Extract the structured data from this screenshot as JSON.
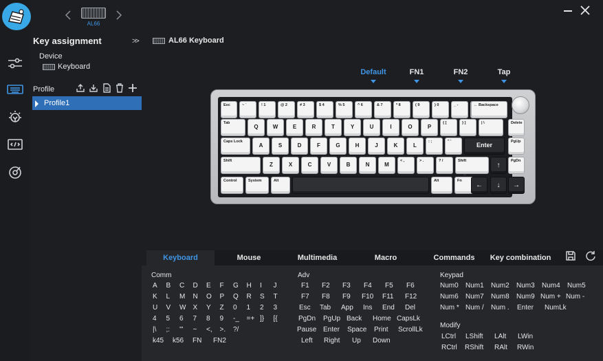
{
  "app": {
    "device_short": "AL66"
  },
  "sidebar": {
    "title": "Key assignment",
    "device_label": "Device",
    "device_value": "Keyboard",
    "profile_label": "Profile",
    "profiles": [
      "Profile1"
    ]
  },
  "main": {
    "keyboard_title": "AL66 Keyboard",
    "layers": [
      "Default",
      "FN1",
      "FN2",
      "Tap"
    ],
    "active_layer": "Default"
  },
  "keyboard": {
    "rows": [
      [
        "Esc",
        "~ `",
        "! 1",
        "@ 2",
        "# 3",
        "$ 4",
        "% 5",
        "^ 6",
        "& 7",
        "* 8",
        "( 9",
        ") 0",
        "_ -",
        "+ =",
        "← Backspace"
      ],
      [
        "Tab",
        "Q",
        "W",
        "E",
        "R",
        "T",
        "Y",
        "U",
        "I",
        "O",
        "P",
        "{ [",
        "} ]",
        "| \\",
        "Delete"
      ],
      [
        "Caps Lock",
        "A",
        "S",
        "D",
        "F",
        "G",
        "H",
        "J",
        "K",
        "L",
        ": ;",
        "\" '",
        "Enter",
        "PgUp"
      ],
      [
        "Shift",
        "Z",
        "X",
        "C",
        "V",
        "B",
        "N",
        "M",
        "< ,",
        "> .",
        "? /",
        "Shift",
        "↑",
        "PgDn"
      ],
      [
        "Control",
        "System",
        "Alt",
        "",
        "Alt",
        "Fn",
        "←",
        "↓",
        "→"
      ]
    ]
  },
  "tabs": [
    "Keyboard",
    "Mouse",
    "Multimedia",
    "Macro",
    "Commands",
    "Key combination"
  ],
  "active_tab": "Keyboard",
  "palette": {
    "comm": {
      "title": "Comm",
      "rows": [
        [
          "A",
          "B",
          "C",
          "D",
          "E",
          "F",
          "G",
          "H",
          "I",
          "J"
        ],
        [
          "K",
          "L",
          "M",
          "N",
          "O",
          "P",
          "Q",
          "R",
          "S",
          "T"
        ],
        [
          "U",
          "V",
          "W",
          "X",
          "Y",
          "Z",
          "0",
          "1",
          "2",
          "3"
        ],
        [
          "4",
          "5",
          "6",
          "7",
          "8",
          "9",
          "-_",
          "=+",
          "]}",
          "[{"
        ],
        [
          "|\\",
          ";:",
          "'\"",
          "~",
          "<,",
          ">.",
          "?/"
        ],
        [
          "k45",
          "k56",
          "FN",
          "FN2"
        ]
      ]
    },
    "adv": {
      "title": "Adv",
      "rows": [
        [
          "F1",
          "F2",
          "F3",
          "F4",
          "F5",
          "F6"
        ],
        [
          "F7",
          "F8",
          "F9",
          "F10",
          "F11",
          "F12"
        ],
        [
          "Esc",
          "Tab",
          "App",
          "Ins",
          "End",
          "Del"
        ],
        [
          "PgDn",
          "PgUp",
          "Back",
          "Home",
          "CapsLk"
        ],
        [
          "Pause",
          "Enter",
          "Space",
          "Print",
          "ScrollLk"
        ],
        [
          "Left",
          "Right",
          "Up",
          "Down"
        ]
      ]
    },
    "keypad": {
      "title": "Keypad",
      "rows": [
        [
          "Num0",
          "Num1",
          "Num2",
          "Num3",
          "Num4",
          "Num5"
        ],
        [
          "Num6",
          "Num7",
          "Num8",
          "Num9",
          "Num +",
          "Num -"
        ],
        [
          "Num *",
          "Num /",
          "Num .",
          "Enter",
          "NumLk"
        ]
      ]
    },
    "modify": {
      "title": "Modify",
      "rows": [
        [
          "LCtrl",
          "LShift",
          "LAlt",
          "LWin"
        ],
        [
          "RCtrl",
          "RShift",
          "RAlt",
          "RWin"
        ]
      ]
    }
  },
  "colors": {
    "accent": "#3f95e4",
    "selection": "#2e6fb8",
    "background": "#1d1e22"
  }
}
